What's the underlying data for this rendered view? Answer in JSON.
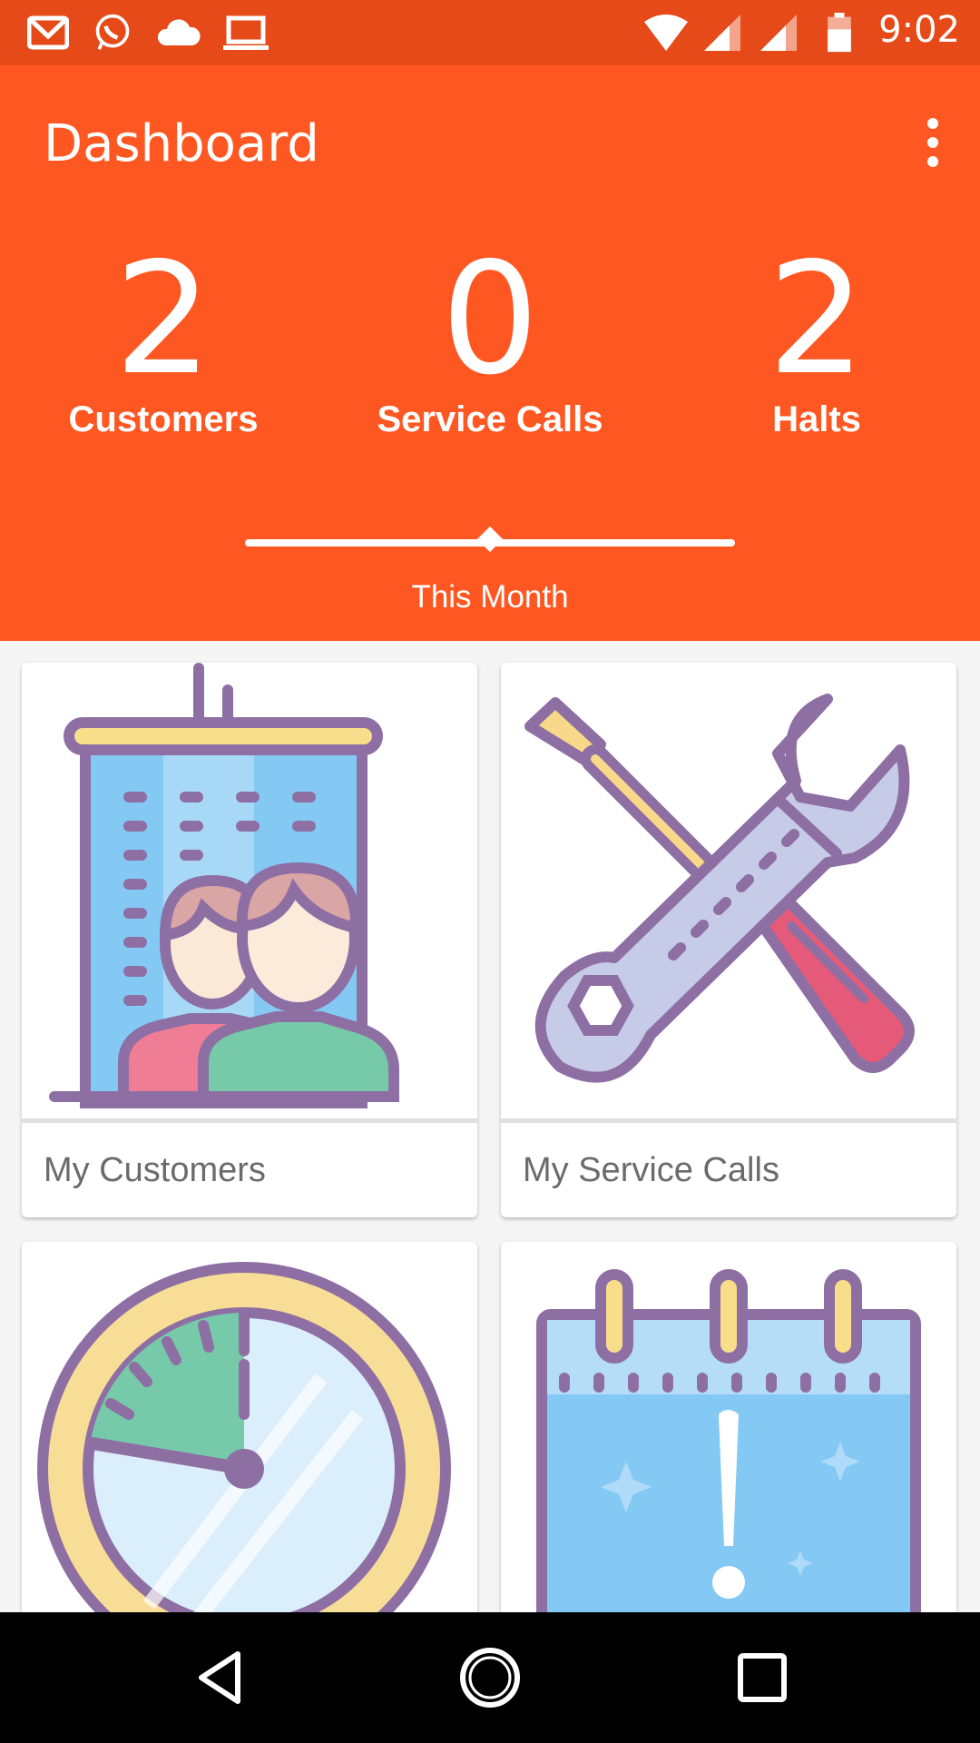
{
  "status_bar": {
    "time": "9:02"
  },
  "header": {
    "title": "Dashboard"
  },
  "stats": [
    {
      "value": "2",
      "label": "Customers"
    },
    {
      "value": "0",
      "label": "Service Calls"
    },
    {
      "value": "2",
      "label": "Halts"
    }
  ],
  "period_label": "This Month",
  "cards": [
    {
      "label": "My Customers",
      "icon": "customers-building-icon"
    },
    {
      "label": "My Service Calls",
      "icon": "tools-icon"
    },
    {
      "label": "",
      "icon": "clock-icon"
    },
    {
      "label": "",
      "icon": "calendar-alert-icon"
    }
  ],
  "colors": {
    "status_bar": "#e64a19",
    "app_bar": "#ff5722",
    "accent_purple": "#8e6fa4"
  }
}
